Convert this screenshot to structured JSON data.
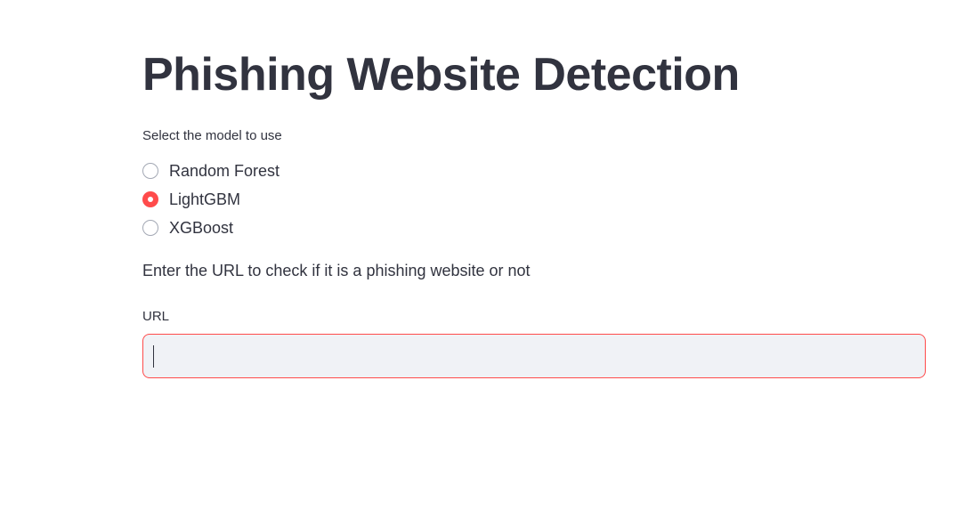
{
  "app": {
    "title": "Phishing Website Detection"
  },
  "model_select": {
    "label": "Select the model to use",
    "options": [
      {
        "label": "Random Forest",
        "selected": false
      },
      {
        "label": "LightGBM",
        "selected": true
      },
      {
        "label": "XGBoost",
        "selected": false
      }
    ]
  },
  "instruction": "Enter the URL to check if it is a phishing website or not",
  "url_field": {
    "label": "URL",
    "value": "",
    "placeholder": ""
  },
  "colors": {
    "accent": "#ff4b4b",
    "text": "#31333f",
    "input_bg": "#f0f2f6"
  }
}
